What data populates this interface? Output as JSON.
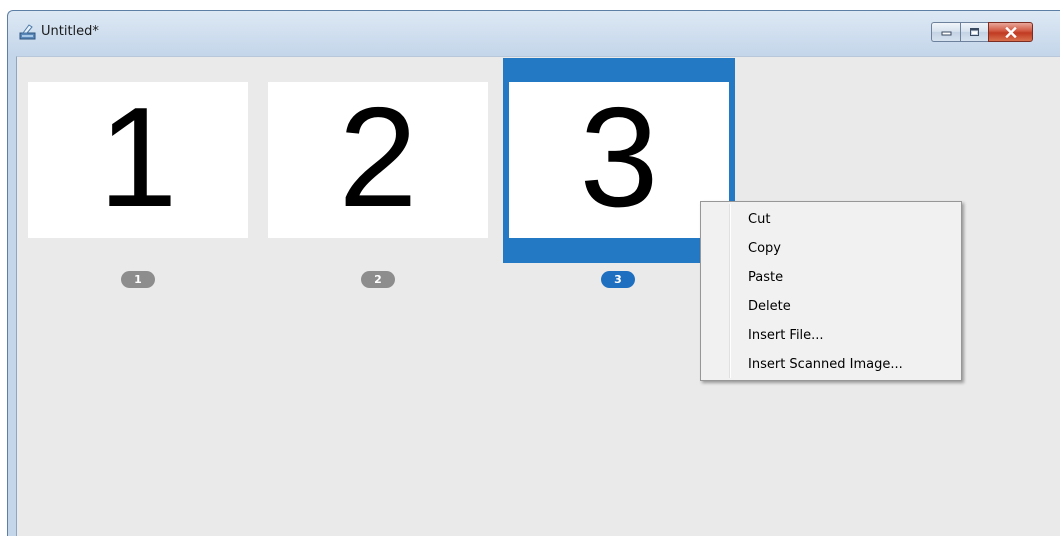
{
  "window": {
    "title": "Untitled*"
  },
  "pages": [
    {
      "number": "1",
      "badge": "1",
      "selected": false
    },
    {
      "number": "2",
      "badge": "2",
      "selected": false
    },
    {
      "number": "3",
      "badge": "3",
      "selected": true
    }
  ],
  "context_menu": {
    "items": [
      "Cut",
      "Copy",
      "Paste",
      "Delete",
      "Insert File...",
      "Insert Scanned Image..."
    ]
  },
  "colors": {
    "selection": "#2479c5",
    "badge_selected": "#1f6fc0",
    "badge_default": "#8d8d8d",
    "close_button": "#c03a22"
  },
  "icons": {
    "app": "scanner-app-icon",
    "minimize": "minimize-icon",
    "maximize": "maximize-icon",
    "close": "close-icon"
  }
}
